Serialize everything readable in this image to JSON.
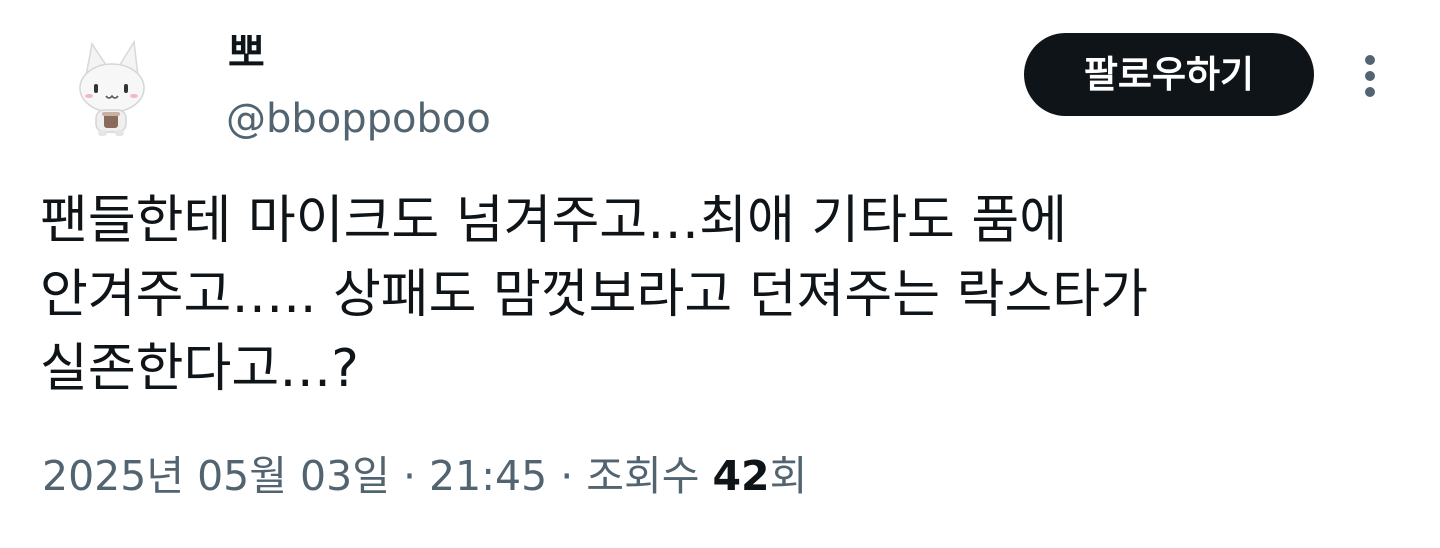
{
  "author": {
    "display_name": "뽀",
    "handle": "@bboppoboo",
    "avatar_icon": "white-cat-avatar"
  },
  "actions": {
    "follow_label": "팔로우하기",
    "more_icon": "more-vertical-icon"
  },
  "tweet": {
    "lines": [
      "팬들한테 마이크도 넘겨주고…최애 기타도 품에",
      "안겨주고….. 상패도 맘껏보라고 던져주는 락스타가",
      "실존한다고…?"
    ]
  },
  "meta": {
    "date": "2025년 05월 03일",
    "separator": " · ",
    "time": "21:45",
    "views_label": "조회수",
    "views_count": "42",
    "views_unit": "회"
  },
  "colors": {
    "text_primary": "#0f1419",
    "text_secondary": "#536471",
    "button_bg": "#0f1419",
    "button_text": "#ffffff"
  }
}
